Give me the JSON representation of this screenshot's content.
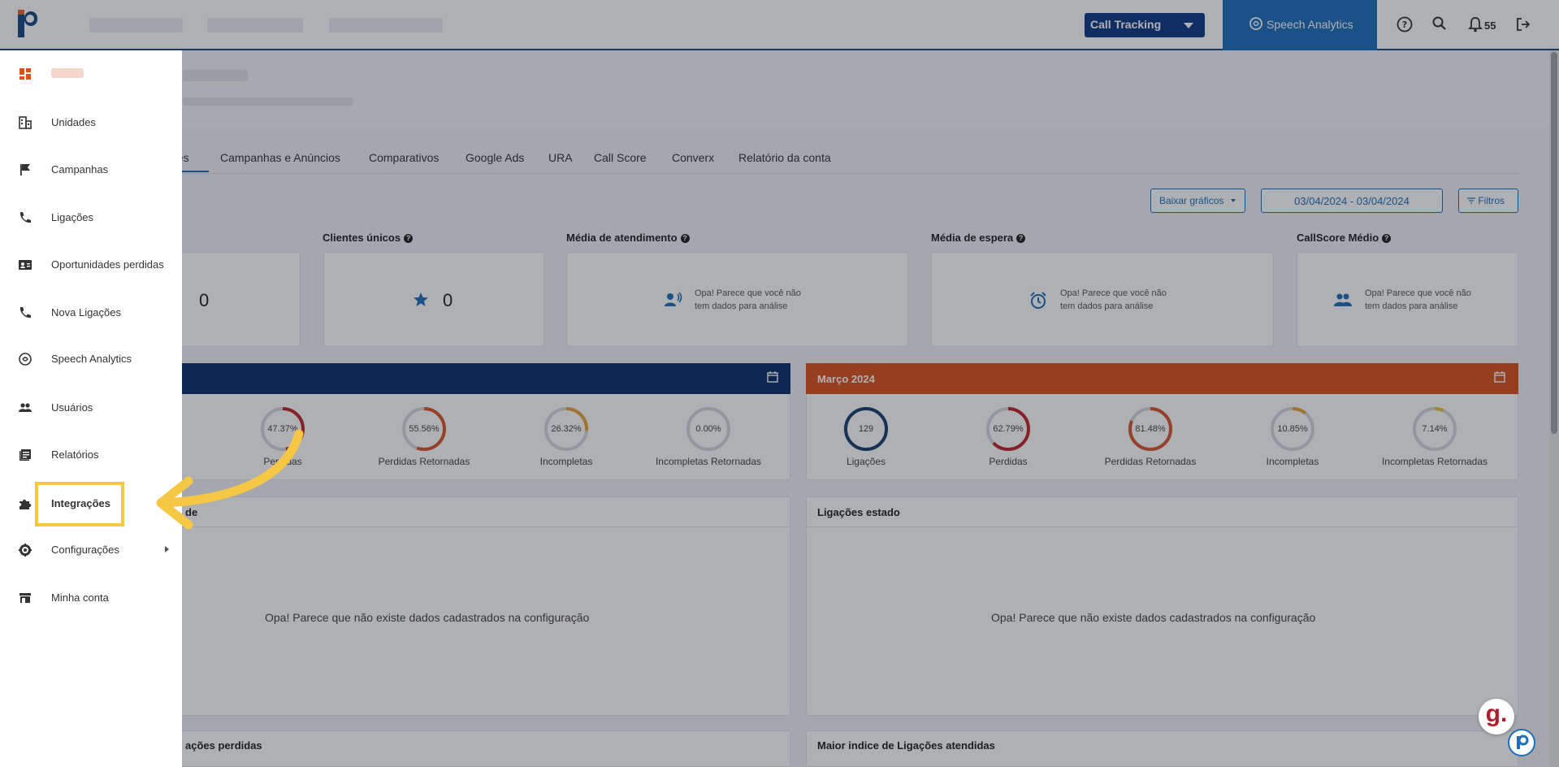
{
  "header": {
    "call_tracking_label": "Call Tracking",
    "speech_analytics_label": "Speech Analytics",
    "notification_count": "55"
  },
  "tabs": [
    "ões",
    "Campanhas e Anúncios",
    "Comparativos",
    "Google Ads",
    "URA",
    "Call Score",
    "Converx",
    "Relatório da conta"
  ],
  "controls": {
    "download_label": "Baixar gráficos",
    "date_range": "03/04/2024 - 03/04/2024",
    "filters_label": "Filtros"
  },
  "kpis": [
    {
      "title": "Clientes únicos",
      "value": "0"
    },
    {
      "title": "Média de atendimento",
      "message_line1": "Opa! Parece que você não",
      "message_line2": "tem dados para análise"
    },
    {
      "title": "Média de espera",
      "message_line1": "Opa! Parece que você não",
      "message_line2": "tem dados para análise"
    },
    {
      "title": "CallScore Médio",
      "message_line1": "Opa! Parece que você não",
      "message_line2": "tem dados para análise"
    }
  ],
  "kpi_first_value": "0",
  "left_panel": {
    "gauges": [
      {
        "value": "47.37%",
        "label": "Perdidas",
        "fraction": 0.4737,
        "color": "#c0262c"
      },
      {
        "value": "55.56%",
        "label": "Perdidas Retornadas",
        "fraction": 0.5556,
        "color": "#d8552d"
      },
      {
        "value": "26.32%",
        "label": "Incompletas",
        "fraction": 0.2632,
        "color": "#e8a33a"
      },
      {
        "value": "0.00%",
        "label": "Incompletas Retornadas",
        "fraction": 0.0,
        "color": "#e8c23a"
      }
    ]
  },
  "right_panel": {
    "title": "Março 2024",
    "gauges": [
      {
        "value": "129",
        "label": "Ligações",
        "fraction": 1.0,
        "color": "#17406f"
      },
      {
        "value": "62.79%",
        "label": "Perdidas",
        "fraction": 0.6279,
        "color": "#c0262c"
      },
      {
        "value": "81.48%",
        "label": "Perdidas Retornadas",
        "fraction": 0.8148,
        "color": "#d8552d"
      },
      {
        "value": "10.85%",
        "label": "Incompletas",
        "fraction": 0.1085,
        "color": "#e8a33a"
      },
      {
        "value": "7.14%",
        "label": "Incompletas Retornadas",
        "fraction": 0.0714,
        "color": "#e8c23a"
      }
    ]
  },
  "sections": {
    "left_title_fragment": "de",
    "right_title": "Ligações estado",
    "empty_message": "Opa! Parece que não existe dados cadastrados na configuração",
    "bottom_left_fragment": "ações perdidas",
    "bottom_right_title": "Maior indice de Ligações atendidas"
  },
  "sidebar": {
    "items": [
      {
        "label": "Unidades",
        "icon": "building-icon"
      },
      {
        "label": "Campanhas",
        "icon": "flag-icon"
      },
      {
        "label": "Ligações",
        "icon": "phone-icon"
      },
      {
        "label": "Oportunidades perdidas",
        "icon": "contact-card-icon"
      },
      {
        "label": "Nova Ligações",
        "icon": "phone-icon"
      },
      {
        "label": "Speech Analytics",
        "icon": "speech-analytics-icon"
      },
      {
        "label": "Usuários",
        "icon": "users-icon"
      },
      {
        "label": "Relatórios",
        "icon": "reports-icon"
      },
      {
        "label": "Integrações",
        "icon": "puzzle-icon"
      },
      {
        "label": "Configurações",
        "icon": "gear-icon"
      },
      {
        "label": "Minha conta",
        "icon": "store-icon"
      }
    ]
  },
  "badge_letter": "g."
}
